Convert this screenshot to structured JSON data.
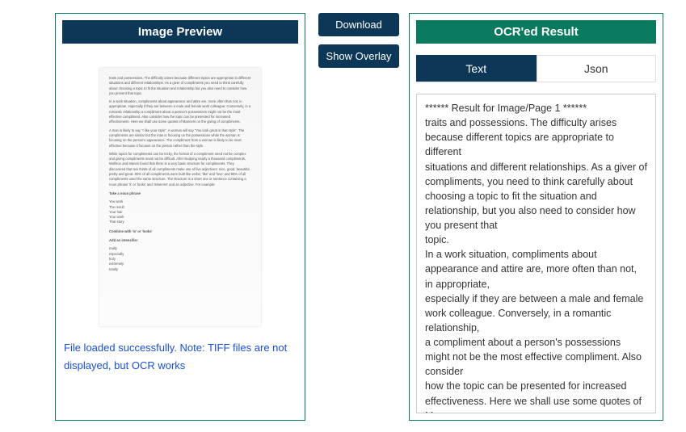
{
  "preview": {
    "header": "Image Preview",
    "status": "File loaded successfully. Note: TIFF files are not displayed, but OCR works"
  },
  "buttons": {
    "download": "Download",
    "overlay": "Show Overlay"
  },
  "result": {
    "header": "OCR'ed Result",
    "tabs": {
      "text": "Text",
      "json": "Json"
    },
    "ocr_text": "****** Result for Image/Page 1 ******\ntraits and possessions. The difficulty arises because different topics are appropriate to different\nsituations and different relationships. As a giver of compliments, you need to think carefully about\nchoosing a topic to fit the situation and relationship, but you also need to consider how you present that\ntopic.\nIn a work situation, compliments about appearance and attire are, more often than not, in appropriate,\nespecially if they are between a male and female work colleague. Conversely, in a romantic relationship,\na compliment about a person's possessions might not be the most effective compliment. Also consider\nhow the topic can be presented for increased effectiveness. Here we shall use some quotes of Manners"
  },
  "doc_preview": {
    "p1": "traits and possessions. The difficulty arises because different topics are appropriate to different situations and different relationships. As a giver of compliments you need to think carefully about choosing a topic to fit the situation and relationship but you also need to consider how you present that topic.",
    "p2": "In a work situation, compliments about appearance and attire are, more often than not, in appropriate, especially if they are between a male and female work colleague. Conversely, in a romantic relationship a compliment about a person's possessions might not be the most effective compliment. Also consider how the topic can be presented for increased effectiveness. Here we shall use some quotes of Manners on the giving of compliments.",
    "p3": "A man is likely to say \"I like your style\". A woman will say \"You look great in that style\". The compliments are similar but the man is focusing on the possessions while the woman is focusing on the person's appearance. The compliment from a woman is likely to be most effective because it focuses on the person rather than the style.",
    "p4": "While topics for compliments can be tricky, the format of a compliment need not be complex and giving compliments need not be difficult. After studying nearly a thousand compliments, Wolfson and Manes found that there is a very basic structure for compliments. They discovered that two thirds of all compliments make use of five adjectives: nice, good, beautiful, pretty and great. 80% of all compliments were built like verbs: 'like' and 'love' and 85% of all compliments used the same structure. The structure is a short one or sentence containing a noun phrase 'it' or 'looks' and 'is/seems' and an adjective. For example:",
    "h1": "Take a noun phrase",
    "l1": "You work\nThe result\nYour hair\nYour work\nThat story",
    "h2": "Combine with 'is' or 'looks'",
    "h3": "Add an intensifier",
    "l2": "really\nespecially\ntruly\nextremely\ntotally"
  }
}
